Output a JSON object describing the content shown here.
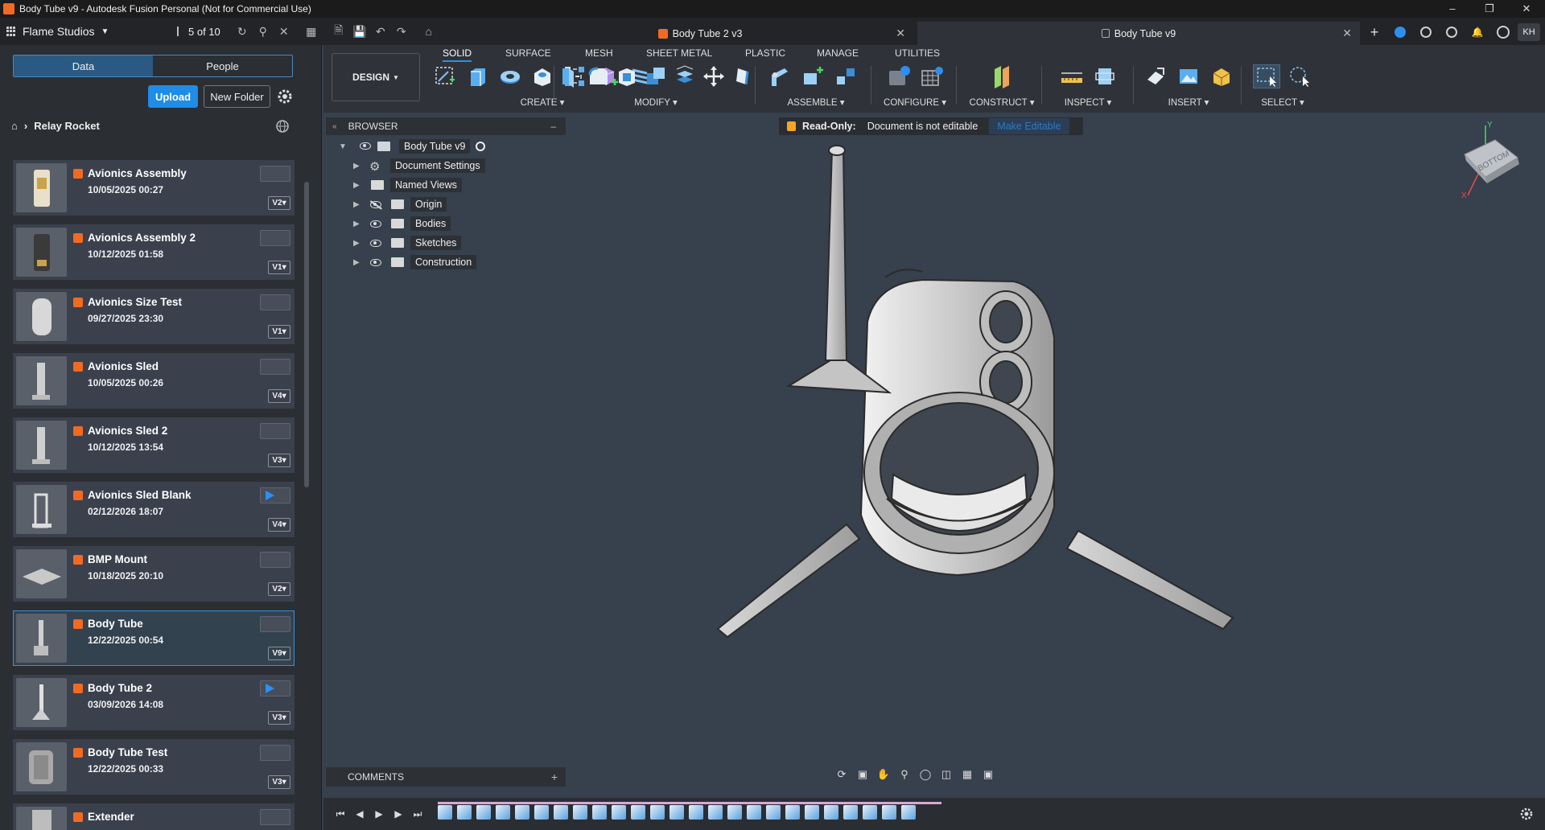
{
  "window": {
    "title": "Body Tube v9 - Autodesk Fusion Personal (Not for Commercial Use)"
  },
  "appbar": {
    "team": "Flame Studios",
    "version_counter": "5 of 10"
  },
  "tabs": [
    {
      "label": "Body Tube 2 v3"
    },
    {
      "label": "Body Tube v9"
    }
  ],
  "user": {
    "initials": "KH"
  },
  "datapanel": {
    "tabs": [
      "Data",
      "People"
    ],
    "upload_label": "Upload",
    "new_folder_label": "New Folder",
    "breadcrumb": "Relay Rocket",
    "files": [
      {
        "name": "Avionics Assembly",
        "date": "10/05/2025 00:27",
        "version": "V2"
      },
      {
        "name": "Avionics Assembly 2",
        "date": "10/12/2025 01:58",
        "version": "V1"
      },
      {
        "name": "Avionics Size Test",
        "date": "09/27/2025 23:30",
        "version": "V1"
      },
      {
        "name": "Avionics Sled",
        "date": "10/05/2025 00:26",
        "version": "V4"
      },
      {
        "name": "Avionics Sled 2",
        "date": "10/12/2025 13:54",
        "version": "V3"
      },
      {
        "name": "Avionics Sled Blank",
        "date": "02/12/2026 18:07",
        "version": "V4"
      },
      {
        "name": "BMP Mount",
        "date": "10/18/2025 20:10",
        "version": "V2"
      },
      {
        "name": "Body Tube",
        "date": "12/22/2025 00:54",
        "version": "V9"
      },
      {
        "name": "Body Tube 2",
        "date": "03/09/2026 14:08",
        "version": "V3"
      },
      {
        "name": "Body Tube Test",
        "date": "12/22/2025 00:33",
        "version": "V3"
      },
      {
        "name": "Extender",
        "date": "",
        "version": ""
      }
    ]
  },
  "toolbar": {
    "workspace": "DESIGN",
    "tabs": [
      "SOLID",
      "SURFACE",
      "MESH",
      "SHEET METAL",
      "PLASTIC",
      "MANAGE",
      "UTILITIES"
    ],
    "groups": [
      "CREATE",
      "MODIFY",
      "ASSEMBLE",
      "CONFIGURE",
      "CONSTRUCT",
      "INSPECT",
      "INSERT",
      "SELECT"
    ]
  },
  "browser": {
    "title": "BROWSER",
    "root": "Body Tube v9",
    "items": [
      "Document Settings",
      "Named Views",
      "Origin",
      "Bodies",
      "Sketches",
      "Construction"
    ]
  },
  "readonly": {
    "label": "Read-Only:",
    "message": "Document is not editable",
    "action": "Make Editable"
  },
  "viewcube": {
    "face": "BOTTOM",
    "axis_y": "Y",
    "axis_x": "X"
  },
  "comments": {
    "title": "COMMENTS"
  },
  "colors": {
    "accent": "#2d8ff0",
    "brand": "#f26a22",
    "background": "#37404d"
  }
}
